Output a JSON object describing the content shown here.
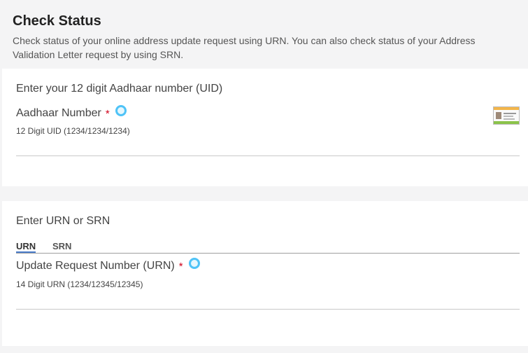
{
  "header": {
    "title": "Check Status",
    "description": "Check status of your online address update request using URN. You can also check status of your Address Validation Letter request by using SRN."
  },
  "uid_section": {
    "heading": "Enter your 12 digit Aadhaar number (UID)",
    "field_label": "Aadhaar Number",
    "required_mark": "*",
    "placeholder": "12 Digit UID (1234/1234/1234)",
    "value": ""
  },
  "urn_section": {
    "heading": "Enter URN or SRN",
    "tabs": [
      {
        "label": "URN",
        "active": true
      },
      {
        "label": "SRN",
        "active": false
      }
    ],
    "field_label": "Update Request Number (URN)",
    "required_mark": "*",
    "placeholder": "14 Digit URN (1234/12345/12345)",
    "value": ""
  },
  "colors": {
    "required": "#d0021b",
    "info_icon": "#4fc3f7",
    "active_tab_underline": "#4a7cc9",
    "page_background": "#f4f4f5",
    "card_background": "#ffffff"
  },
  "icons": {
    "info": "info-circle-icon",
    "aadhaar_card": "aadhaar-card-icon"
  }
}
